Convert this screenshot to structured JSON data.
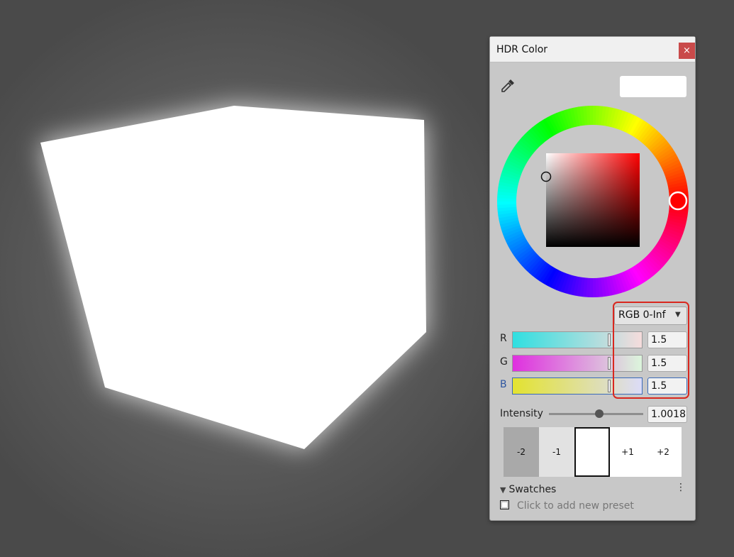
{
  "dialog": {
    "title": "HDR Color",
    "close_glyph": "×",
    "eyedropper_icon": "eyedropper-icon",
    "preview_color": "#ffffff"
  },
  "mode": {
    "label": "RGB 0-Inf",
    "arrow": "▼"
  },
  "channels": [
    {
      "label": "R",
      "value": "1.5",
      "track_from": "#2fdfe0",
      "track_to": "#f6dcdc"
    },
    {
      "label": "G",
      "value": "1.5",
      "track_from": "#df2fdf",
      "track_to": "#dcf6dc"
    },
    {
      "label": "B",
      "value": "1.5",
      "track_from": "#e3e32f",
      "track_to": "#dcdcf8"
    }
  ],
  "intensity": {
    "label": "Intensity",
    "value": "1.0018"
  },
  "exposure": {
    "steps": [
      {
        "label": "-2",
        "color": "#a9a9a9"
      },
      {
        "label": "-1",
        "color": "#e2e2e2"
      },
      {
        "label": "",
        "color": "#ffffff"
      },
      {
        "label": "+1",
        "color": "#ffffff"
      },
      {
        "label": "+2",
        "color": "#ffffff"
      }
    ]
  },
  "swatches": {
    "header": "Swatches",
    "menu_glyph": "⋮",
    "add_preset": "Click to add new preset"
  },
  "colors": {
    "accent_highlight": "#d9271e",
    "focus_blue": "#3a6ab8",
    "hue_marker": "#ff0000"
  }
}
